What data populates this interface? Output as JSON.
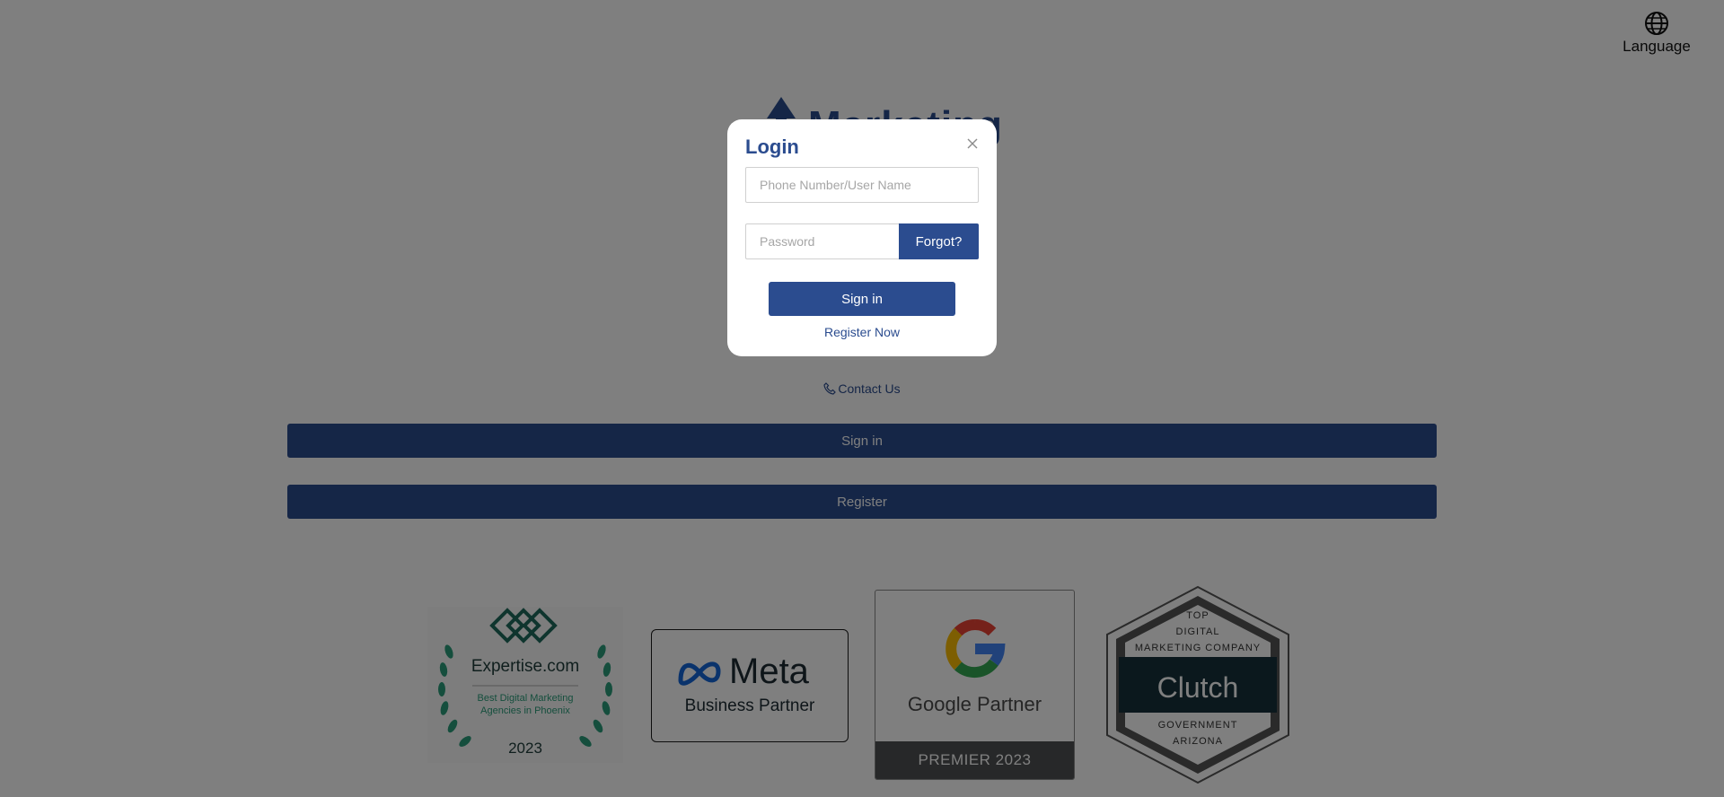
{
  "header": {
    "language_label": "Language",
    "language_icon": "globe-icon"
  },
  "logo": {
    "brand": "Marketing",
    "icon": "arrow-up-icon"
  },
  "contact": {
    "label": "Contact Us",
    "icon": "phone-icon"
  },
  "buttons": {
    "signin": "Sign in",
    "register": "Register"
  },
  "badges": {
    "expertise": {
      "name": "Expertise.com",
      "line1": "Best Digital Marketing",
      "line2": "Agencies in Phoenix",
      "year": "2023"
    },
    "meta": {
      "name": "Meta",
      "sub": "Business Partner"
    },
    "google": {
      "name": "Google Partner",
      "tier": "PREMIER 2023"
    },
    "clutch": {
      "top1": "TOP",
      "top2": "DIGITAL",
      "top3": "MARKETING COMPANY",
      "name": "Clutch",
      "bottom1": "GOVERNMENT",
      "bottom2": "ARIZONA"
    }
  },
  "modal": {
    "title": "Login",
    "username_placeholder": "Phone Number/User Name",
    "password_placeholder": "Password",
    "forgot_label": "Forgot?",
    "signin_label": "Sign in",
    "register_label": "Register Now"
  },
  "colors": {
    "primary": "#2b4c8f",
    "overlay": "rgba(0,0,0,0.5)",
    "expertise_green": "#2a9d7a",
    "clutch_dark": "#17313b"
  }
}
